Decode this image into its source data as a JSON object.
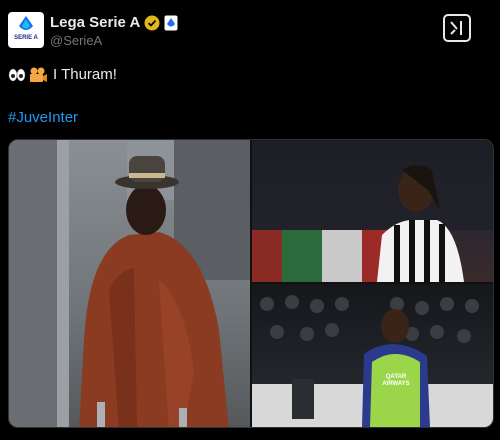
{
  "account": {
    "display_name": "Lega Serie A",
    "handle": "@SerieA",
    "avatar_text": "SERIE A",
    "verified_icon": "gold-verified-badge-icon",
    "affiliate_icon": "affiliate-badge-icon"
  },
  "tweet": {
    "emojis": [
      "eyes-emoji",
      "movie-camera-emoji"
    ],
    "text": "I Thuram!",
    "hashtag": "#JuveInter"
  },
  "grok_button_icon": "grok-icon",
  "media": {
    "photos": [
      {
        "name": "photo-man-in-hat-and-puffer-jacket"
      },
      {
        "name": "photo-player-juventus-kit"
      },
      {
        "name": "photo-player-training-bib-with-crowd"
      }
    ],
    "bib_text": "QATAR AIRWAYS"
  },
  "colors": {
    "background": "#000000",
    "text": "#e7e9ea",
    "muted": "#71767b",
    "link": "#1d9bf0",
    "verified_gold": "#e2b719"
  }
}
